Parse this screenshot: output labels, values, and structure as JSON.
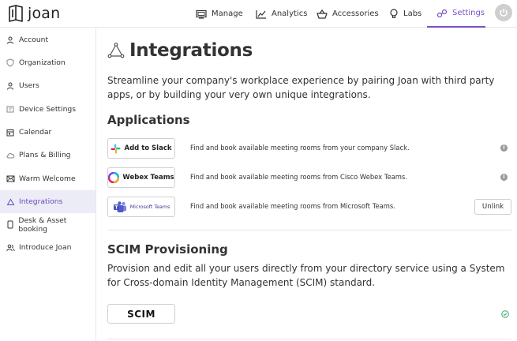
{
  "header": {
    "logo_text": "joan",
    "nav": [
      {
        "label": "Manage",
        "icon": "monitor-icon"
      },
      {
        "label": "Analytics",
        "icon": "chart-icon"
      },
      {
        "label": "Accessories",
        "icon": "basket-icon"
      },
      {
        "label": "Labs",
        "icon": "bulb-icon"
      },
      {
        "label": "Settings",
        "icon": "settings-icon",
        "active": true
      }
    ],
    "power_icon": "power-icon"
  },
  "sidebar": {
    "items": [
      {
        "label": "Account",
        "icon": "user-icon"
      },
      {
        "label": "Organization",
        "icon": "shield-icon"
      },
      {
        "label": "Users",
        "icon": "user-icon"
      },
      {
        "label": "Device Settings",
        "icon": "device-icon"
      },
      {
        "label": "Calendar",
        "icon": "calendar-icon"
      },
      {
        "label": "Plans & Billing",
        "icon": "cloud-icon"
      },
      {
        "label": "Warm Welcome",
        "icon": "mail-icon"
      },
      {
        "label": "Integrations",
        "icon": "triangle-nodes-icon",
        "active": true
      },
      {
        "label": "Desk & Asset booking",
        "icon": "phone-icon"
      },
      {
        "label": "Introduce Joan",
        "icon": "users-icon"
      }
    ]
  },
  "main": {
    "title": "Integrations",
    "intro": "Streamline your company's workplace experience by pairing Joan with third party apps, or by building your very own unique integrations.",
    "applications_title": "Applications",
    "apps": [
      {
        "badge": "Add to Slack",
        "description": "Find and book available meeting rooms from your company Slack.",
        "action": "info"
      },
      {
        "badge": "Webex Teams",
        "description": "Find and book available meeting rooms from Cisco Webex Teams.",
        "action": "info"
      },
      {
        "badge": "Microsoft Teams",
        "description": "Find and book available meeting rooms from Microsoft Teams.",
        "action": "Unlink"
      }
    ],
    "scim_title": "SCIM Provisioning",
    "scim_intro": "Provision and edit all your users directly from your directory service using a System for Cross-domain Identity Management (SCIM) standard.",
    "scim_badge": "SCIM",
    "scim_status_icon": "check-circle-icon"
  },
  "colors": {
    "accent": "#7b4fc9",
    "sidebar_active_bg": "#ececf6",
    "success": "#3aa86b"
  }
}
